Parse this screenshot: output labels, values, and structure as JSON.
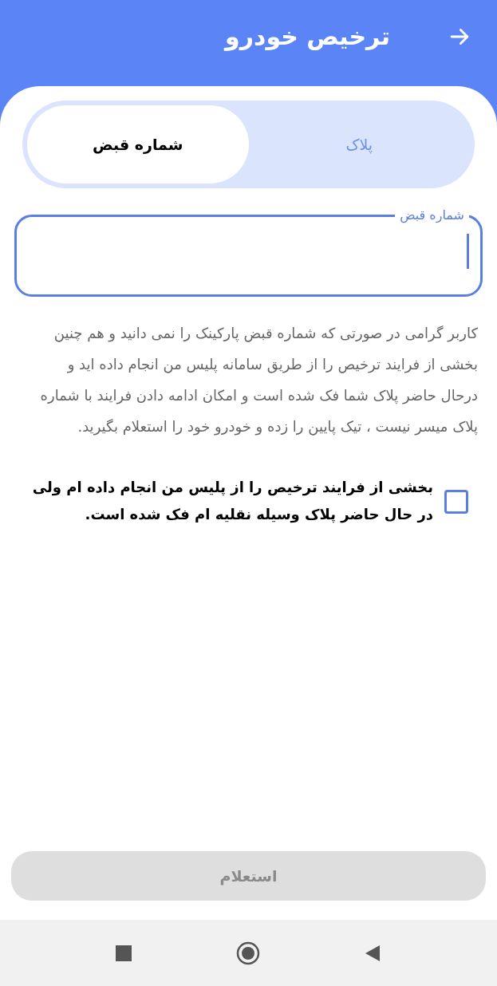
{
  "header": {
    "title": "ترخیص خودرو"
  },
  "tabs": [
    {
      "label": "پلاک",
      "selected": false
    },
    {
      "label": "شماره قبض",
      "selected": true
    }
  ],
  "field": {
    "label": "شماره قبض",
    "focused": true
  },
  "notice": "کاربر گرامی در صورتی که شماره قبض پارکینک را نمی دانید و هم چنین بخشی از فرایند ترخیص را از طریق سامانه پلیس من انجام داده اید و درحال حاضر پلاک شما فک شده است و امکان ادامه دادن فرایند با شماره پلاک میسر نیست ، تیک پایین را زده و خودرو خود را استعلام بگیرید.",
  "checkbox": {
    "label": "بخشی از فرایند ترخیص را از پلیس من انجام داده ام ولی در حال حاضر پلاک وسیله نقلیه ام فک شده است.",
    "checked": false
  },
  "submit": {
    "label": "استعلام",
    "disabled": true
  }
}
